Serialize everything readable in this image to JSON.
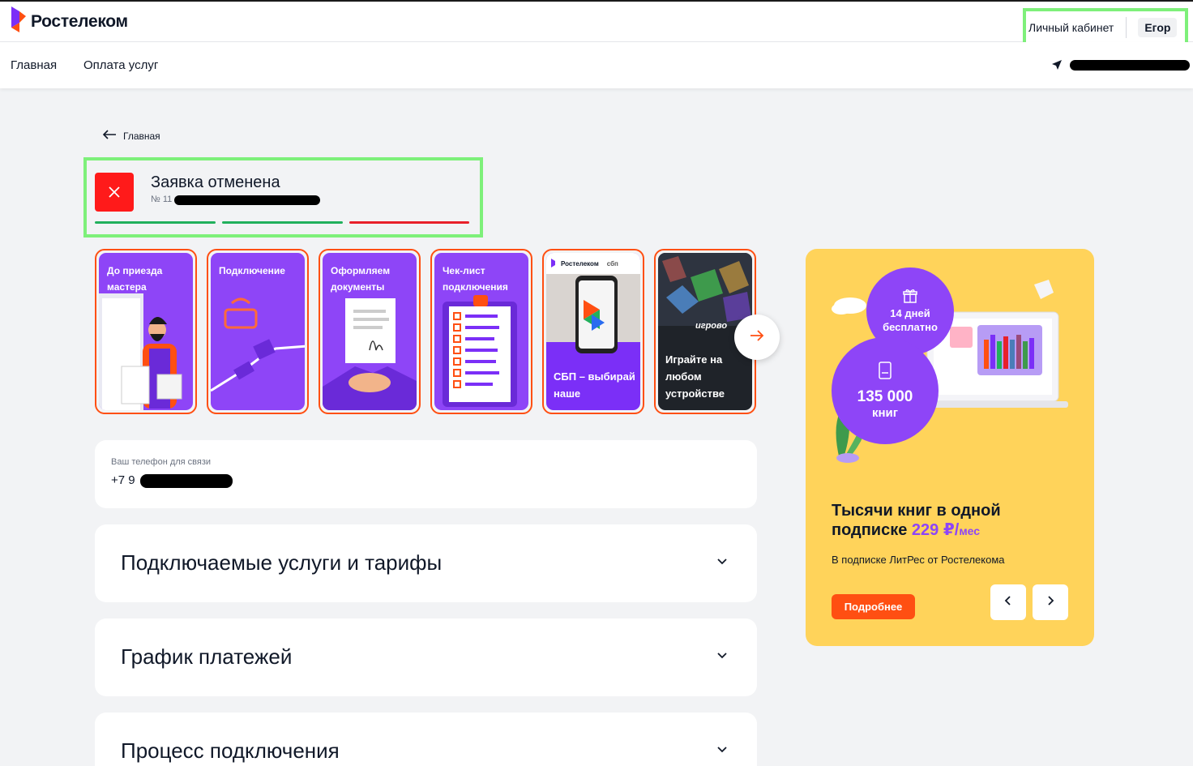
{
  "brand": {
    "name": "Ростелеком",
    "accent": "#8e45f7",
    "orange": "#ff4f12"
  },
  "header": {
    "account_link": "Личный кабинет",
    "user_name": "Егор"
  },
  "nav": {
    "items": [
      "Главная",
      "Оплата услуг"
    ]
  },
  "breadcrumb": {
    "back_label": "Главная"
  },
  "status": {
    "title": "Заявка отменена",
    "number_prefix": "№ 11",
    "progress_colors": [
      "#21b05c",
      "#21b05c",
      "#e8202a"
    ]
  },
  "stories": {
    "items": [
      {
        "title": "До приезда мастера"
      },
      {
        "title": "Подключение"
      },
      {
        "title": "Оформляем документы"
      },
      {
        "title": "Чек-лист подключения"
      },
      {
        "title": "СБП – выбирай наше",
        "logo_text": "Ростелеком",
        "sbp_text": "сбп"
      },
      {
        "title": "Играйте на любом устройстве",
        "image_text": "игрово"
      }
    ]
  },
  "contact": {
    "label": "Ваш телефон для связи",
    "phone_prefix": "+7 9"
  },
  "sections": [
    {
      "title": "Подключаемые услуги и тарифы"
    },
    {
      "title": "График платежей"
    },
    {
      "title": "Процесс подключения"
    }
  ],
  "promo": {
    "bubble_days": "14 дней бесплатно",
    "bubble_books_number": "135 000",
    "bubble_books_unit": "книг",
    "heading_line1": "Тысячи книг в одной",
    "heading_line2": "подписке",
    "price": "229 ₽/",
    "price_unit": "мес",
    "subtitle": "В подписке ЛитРес от Ростелекома",
    "button": "Подробнее"
  }
}
